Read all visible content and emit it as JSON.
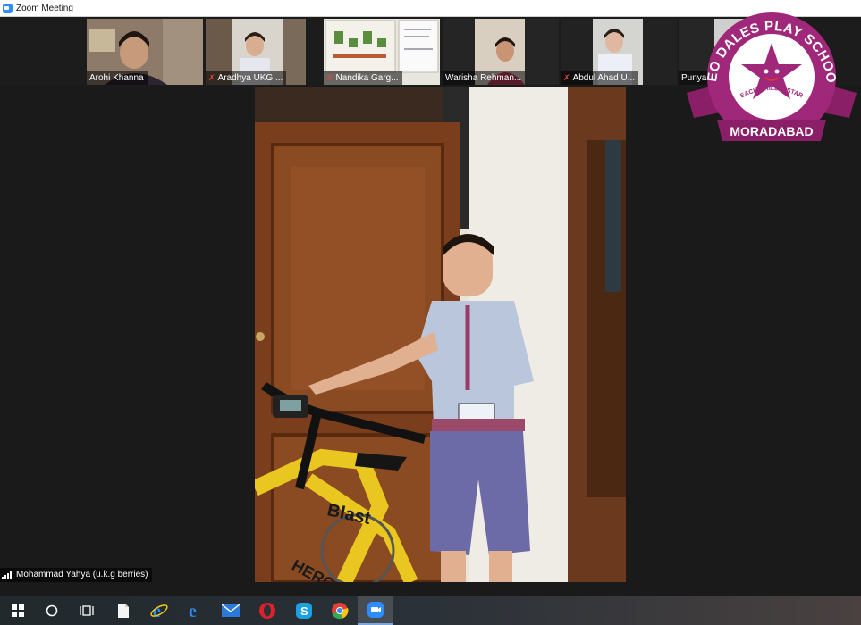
{
  "window": {
    "title": "Zoom Meeting"
  },
  "participants": [
    {
      "name": "Arohi Khanna",
      "muted": false
    },
    {
      "name": "Aradhya UKG ...",
      "muted": true
    },
    {
      "name": "Nandika Garg...",
      "muted": true
    },
    {
      "name": "Warisha Rehman...",
      "muted": false
    },
    {
      "name": "Abdul Ahad U...",
      "muted": true
    },
    {
      "name": "Punya",
      "muted": false
    }
  ],
  "active_speaker": {
    "name": "Mohammad Yahya (u.k.g berries)"
  },
  "video_text": {
    "bike_brand": "Blast",
    "bike_make": "HERO"
  },
  "logo": {
    "top_text": "NEO DALES PLAY SCHOOL",
    "tagline": "EACH CHILD A STAR",
    "city": "MORADABAD",
    "color": "#a0287a"
  },
  "taskbar": {
    "items": [
      {
        "icon": "windows-start-icon"
      },
      {
        "icon": "search-circle-icon"
      },
      {
        "icon": "task-view-icon"
      },
      {
        "icon": "file-icon"
      },
      {
        "icon": "internet-explorer-icon"
      },
      {
        "icon": "edge-legacy-icon"
      },
      {
        "icon": "mail-icon"
      },
      {
        "icon": "opera-icon"
      },
      {
        "icon": "skype-icon"
      },
      {
        "icon": "chrome-icon"
      },
      {
        "icon": "zoom-icon"
      }
    ]
  }
}
